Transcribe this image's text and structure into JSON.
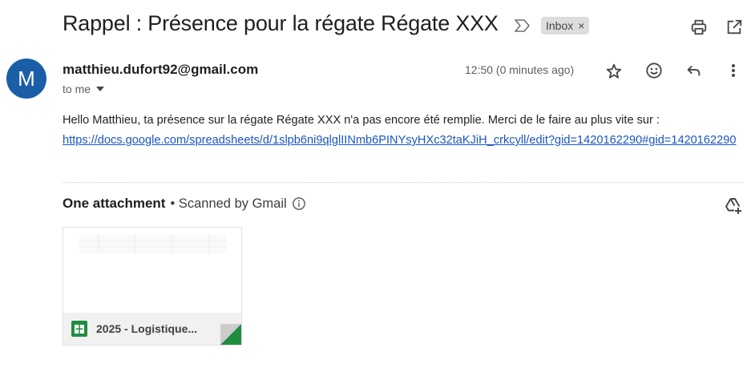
{
  "email": {
    "subject": "Rappel : Présence pour la régate Régate XXX",
    "label_chip": "Inbox",
    "label_chip_close": "×",
    "sender_initial": "M",
    "sender_email": "matthieu.dufort92@gmail.com",
    "recipient_text": "to me",
    "time": "12:50 (0 minutes ago)",
    "body_text": "Hello Matthieu, ta présence sur la régate Régate XXX n'a pas encore été remplie. Merci de le faire au plus vite sur :",
    "body_link": "https://docs.google.com/spreadsheets/d/1slpb6ni9qlglIINmb6PINYsyHXc32taKJiH_crkcyll/edit?gid=1420162290#gid=1420162290"
  },
  "attachments": {
    "heading": "One attachment",
    "scan_note": "• Scanned by Gmail",
    "items": [
      {
        "name": "2025 - Logistique...",
        "file_type": "google-sheets"
      }
    ]
  },
  "colors": {
    "avatar_bg": "#1a5ea8",
    "link": "#1a55c2",
    "sheets_green": "#1e8e3e",
    "chip_bg": "#dddddd"
  },
  "icons": {
    "importance": "importance-marker-icon",
    "print": "print-icon",
    "open_new_window": "open-in-new-window-icon",
    "star": "star-icon",
    "emoji": "emoji-reaction-icon",
    "reply": "reply-icon",
    "more": "more-vertical-icon",
    "chevron": "chevron-down-icon",
    "info": "info-icon",
    "drive_add": "add-to-drive-icon",
    "sheets": "google-sheets-icon"
  }
}
